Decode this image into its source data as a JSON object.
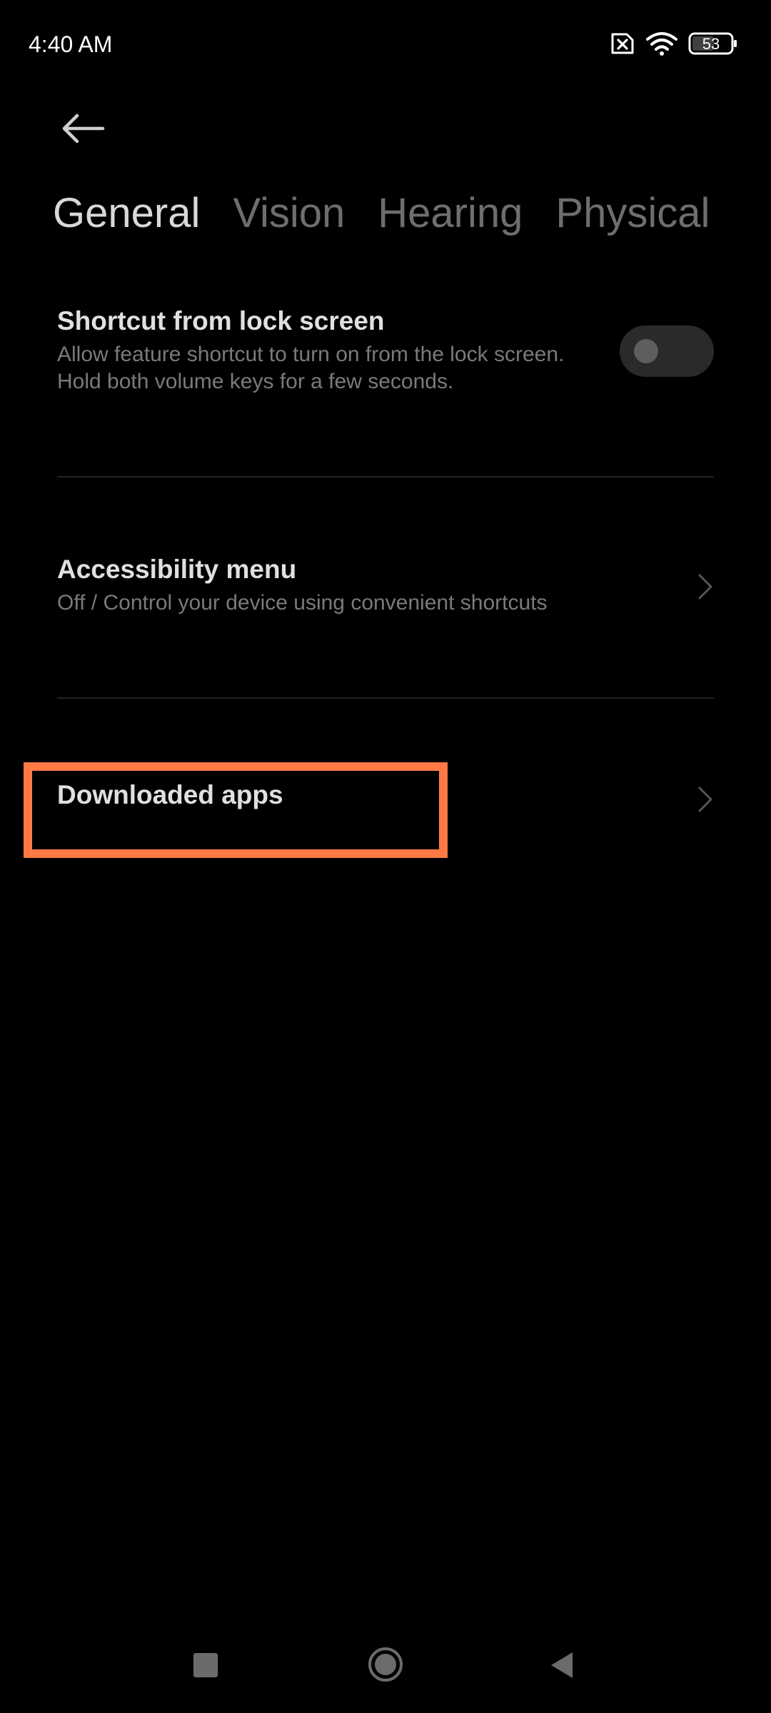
{
  "status_bar": {
    "time": "4:40 AM",
    "battery_level": "53",
    "icons": [
      "sim-error-icon",
      "wifi-icon",
      "battery-icon"
    ]
  },
  "header": {
    "back_icon": "arrow-left-icon"
  },
  "tabs": [
    {
      "label": "General",
      "active": true
    },
    {
      "label": "Vision",
      "active": false
    },
    {
      "label": "Hearing",
      "active": false
    },
    {
      "label": "Physical",
      "active": false
    }
  ],
  "settings": {
    "shortcut": {
      "title": "Shortcut from lock screen",
      "description": "Allow feature shortcut to turn on from the lock screen. Hold both volume keys for a few seconds.",
      "enabled": false
    },
    "accessibility_menu": {
      "title": "Accessibility menu",
      "description": "Off / Control your device using convenient shortcuts"
    },
    "downloaded_apps": {
      "title": "Downloaded apps"
    }
  },
  "nav_bar": {
    "icons": [
      "recents-icon",
      "home-icon",
      "back-icon"
    ]
  },
  "colors": {
    "background": "#000000",
    "highlight": "#ff7a45",
    "active_tab": "#d9d9d9",
    "inactive_tab": "#6e6e6e"
  }
}
